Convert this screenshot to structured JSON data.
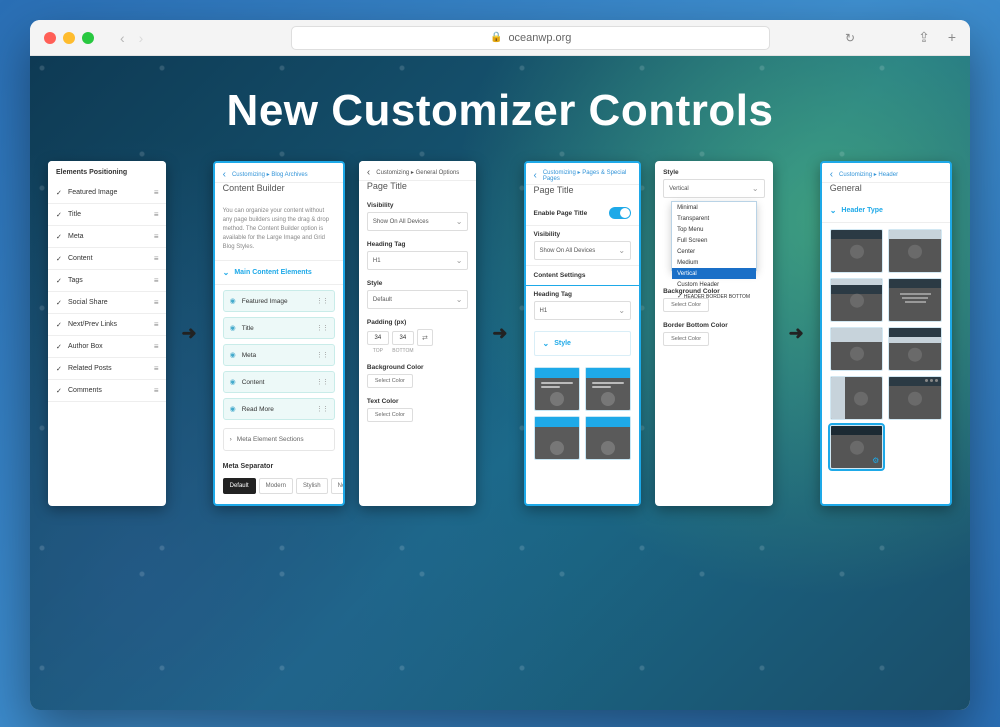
{
  "browser": {
    "url": "oceanwp.org"
  },
  "hero_title": "New Customizer Controls",
  "panel1_old": {
    "heading": "Elements Positioning",
    "items": [
      "Featured Image",
      "Title",
      "Meta",
      "Content",
      "Tags",
      "Social Share",
      "Next/Prev Links",
      "Author Box",
      "Related Posts",
      "Comments"
    ]
  },
  "panel1_new": {
    "crumb_prefix": "Customizing ▸",
    "crumb_section": "Blog Archives",
    "title": "Content Builder",
    "description": "You can organize your content without any page builders using the drag & drop method. The Content Builder option is available for the Large Image and Grid Blog Styles.",
    "accordion_main": "Main Content Elements",
    "items": [
      "Featured Image",
      "Title",
      "Meta",
      "Content",
      "Read More"
    ],
    "accordion_meta": "Meta Element Sections",
    "separator_label": "Meta Separator",
    "separator_tabs": [
      "Default",
      "Modern",
      "Stylish",
      "None"
    ]
  },
  "panel2_old": {
    "crumb_prefix": "Customizing ▸",
    "crumb_section": "General Options",
    "title": "Page Title",
    "visibility_label": "Visibility",
    "visibility_value": "Show On All Devices",
    "heading_tag_label": "Heading Tag",
    "heading_tag_value": "H1",
    "style_label": "Style",
    "style_value": "Default",
    "padding_label": "Padding (px)",
    "padding_top": "34",
    "padding_bottom": "34",
    "pad_top_lbl": "TOP",
    "pad_bottom_lbl": "BOTTOM",
    "bg_label": "Background Color",
    "text_label": "Text Color",
    "color_btn": "Select Color"
  },
  "panel2_new": {
    "crumb_prefix": "Customizing ▸",
    "crumb_section": "Pages & Special Pages",
    "title": "Page Title",
    "enable_label": "Enable Page Title",
    "visibility_label": "Visibility",
    "visibility_value": "Show On All Devices",
    "content_settings_label": "Content Settings",
    "heading_tag_label": "Heading Tag",
    "heading_tag_value": "H1",
    "style_accordion": "Style"
  },
  "panel3_old": {
    "style_label": "Style",
    "selected": "Vertical",
    "options": [
      "Minimal",
      "Transparent",
      "Top Menu",
      "Full Screen",
      "Center",
      "Medium",
      "Vertical",
      "Custom Header",
      "HEADER BORDER BOTTOM"
    ],
    "bg_label": "Background Color",
    "border_label": "Border Bottom Color",
    "color_btn": "Select Color"
  },
  "panel3_new": {
    "crumb_prefix": "Customizing ▸",
    "crumb_section": "Header",
    "title": "General",
    "accordion": "Header Type"
  }
}
